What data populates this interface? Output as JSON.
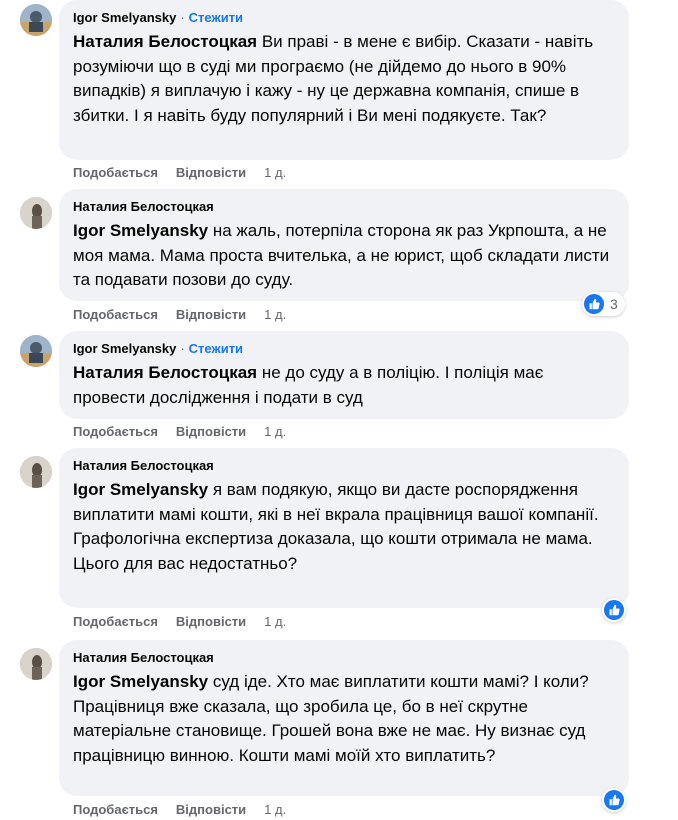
{
  "actions": {
    "like": "Подобається",
    "reply": "Відповісти"
  },
  "comments": [
    {
      "author": "Igor Smelyansky",
      "dot": "·",
      "follow": "Стежити",
      "mention": "Наталия Белостоцкая",
      "text": "Ви праві - в мене є вибір. Сказати - навіть розуміючи що в суді ми програємо (не дійдемо до нього в 90% випадків) я виплачую і кажу - ну це державна компанія, спише в збитки. І я навіть буду популярний і Ви мені подякуєте. Так?",
      "time": "1 д."
    },
    {
      "author": "Наталия Белостоцкая",
      "mention": "Igor Smelyansky",
      "text": "на жаль, потерпіла сторона як раз Укрпошта, а не моя мама. Мама проста вчителька, а не юрист, щоб складати листи та подавати позови до суду.",
      "time": "1 д.",
      "reaction_count": "3"
    },
    {
      "author": "Igor Smelyansky",
      "dot": "·",
      "follow": "Стежити",
      "mention": "Наталия Белостоцкая",
      "text": "не до суду а в поліцію. І поліція має провести дослідження і подати в суд",
      "time": "1 д."
    },
    {
      "author": "Наталия Белостоцкая",
      "mention": "Igor Smelyansky",
      "text": "я вам подякую, якщо ви дасте роспорядження виплатити мамі кошти, які в неї вкрала працівниця вашої компанії.",
      "text2": "Графологічна експертиза доказала, що кошти отримала не мама. Цього для вас недостатньо?",
      "time": "1 д."
    },
    {
      "author": "Наталия Белостоцкая",
      "mention": "Igor Smelyansky",
      "text": "суд іде. Хто має виплатити кошти мамі? І коли? Працівниця вже сказала, що зробила це, бо в неї скрутне матеріальне становище. Грошей вона вже не має. Ну визнає суд працівницю винною. Кошти мамі моїй хто виплатить?",
      "time": "1 д."
    }
  ],
  "colors": {
    "bubble": "#f0f2f5",
    "link": "#1877f2",
    "meta": "#65676b"
  }
}
